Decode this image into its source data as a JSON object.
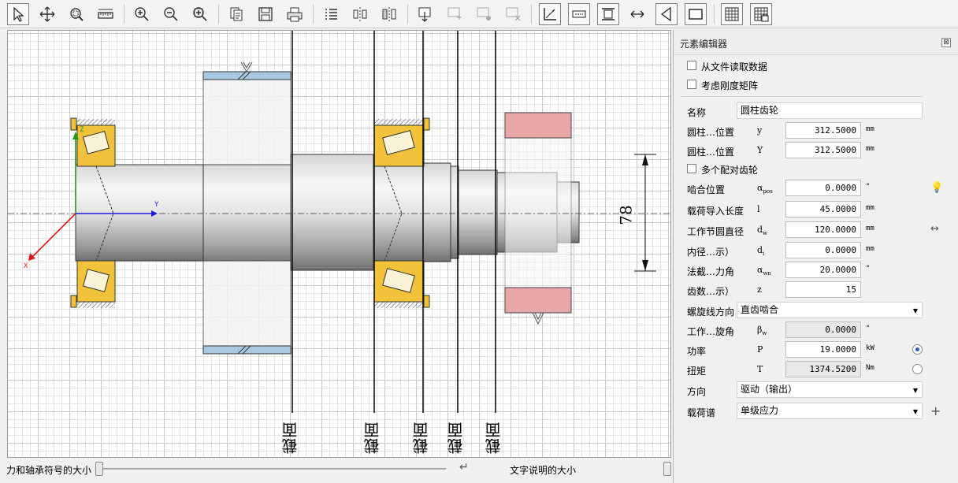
{
  "panel": {
    "title": "元素编辑器",
    "close_glyph": "⊠",
    "checkbox_read_file": "从文件读取数据",
    "checkbox_stiffness": "考虑刚度矩阵",
    "name_label": "名称",
    "name_value": "圆柱齿轮",
    "pos1_label": "圆柱…位置",
    "pos1_symbol": "y",
    "pos1_value": "312.5000",
    "pos1_unit": "mm",
    "pos2_label": "圆柱…位置",
    "pos2_symbol": "Y",
    "pos2_value": "312.5000",
    "pos2_unit": "mm",
    "checkbox_multi_gear": "多个配对齿轮",
    "mesh_label": "啮合位置",
    "mesh_symbol": "α",
    "mesh_sub": "pos",
    "mesh_value": "0.0000",
    "mesh_unit": "°",
    "load_len_label": "载荷导入长度",
    "load_len_symbol": "l",
    "load_len_value": "45.0000",
    "load_len_unit": "mm",
    "pitch_label": "工作节圆直径",
    "pitch_symbol": "d",
    "pitch_sub": "w",
    "pitch_value": "120.0000",
    "pitch_unit": "mm",
    "inner_label": "内径…示）",
    "inner_symbol": "d",
    "inner_sub": "i",
    "inner_value": "0.0000",
    "inner_unit": "mm",
    "pressure_label": "法截…力角",
    "pressure_symbol": "α",
    "pressure_sub": "wn",
    "pressure_value": "20.0000",
    "pressure_unit": "°",
    "teeth_label": "齿数…示）",
    "teeth_symbol": "z",
    "teeth_value": "15",
    "helix_dir_label": "螺旋线方向",
    "helix_dir_value": "直齿啮合",
    "helix_angle_label": "工作…旋角",
    "helix_angle_symbol": "β",
    "helix_angle_sub": "w",
    "helix_angle_value": "0.0000",
    "helix_angle_unit": "°",
    "power_label": "功率",
    "power_symbol": "P",
    "power_value": "19.0000",
    "power_unit": "kW",
    "torque_label": "扭矩",
    "torque_symbol": "T",
    "torque_value": "1374.5200",
    "torque_unit": "Nm",
    "direction_label": "方向",
    "direction_value": "驱动（输出）",
    "spectrum_label": "载荷谱",
    "spectrum_value": "单级应力",
    "bulb_icon": "💡",
    "arrows_icon": "↔",
    "plus_icon": "+"
  },
  "bottom": {
    "force_size_label": "力和轴承符号的大小",
    "text_size_label": "文字说明的大小",
    "enter_glyph": "↵"
  },
  "canvas": {
    "dimension_value": "78",
    "axis_y_label": "Y",
    "axis_z_label": "Z",
    "axis_x_label": "X",
    "section_labels": [
      "截面",
      "截面",
      "截面",
      "截面",
      "截面"
    ]
  }
}
